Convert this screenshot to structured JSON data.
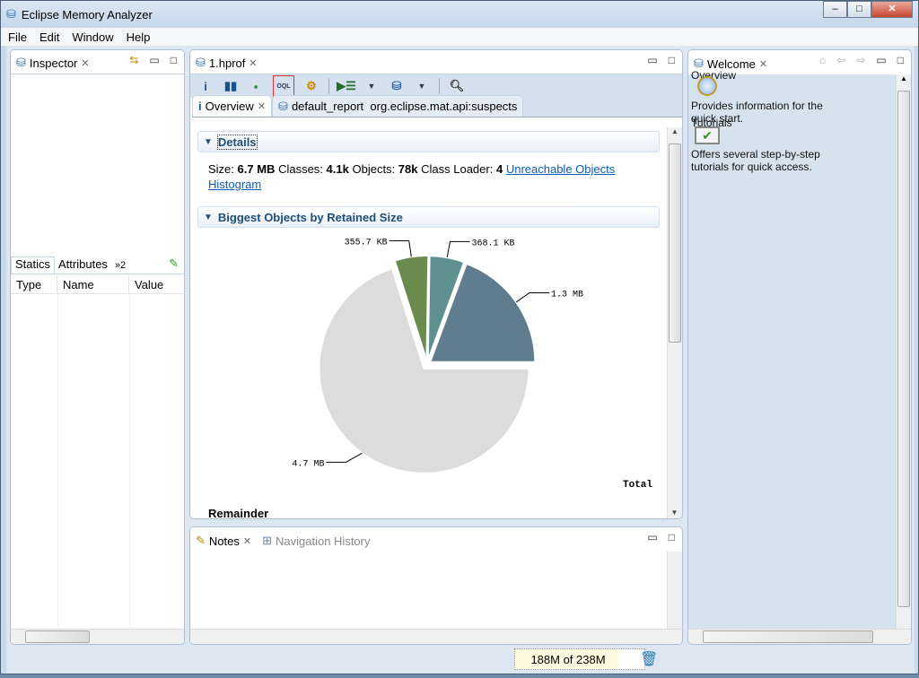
{
  "window": {
    "title": "Eclipse Memory Analyzer",
    "min": "–",
    "max": "□",
    "close": "✕"
  },
  "menu": [
    "File",
    "Edit",
    "Window",
    "Help"
  ],
  "inspector": {
    "tab": "Inspector",
    "subtabs": [
      "Statics",
      "Attributes",
      "»2"
    ],
    "columns": [
      "Type",
      "Name",
      "Value"
    ]
  },
  "editor": {
    "tab": "1.hprof",
    "subtabs": [
      "Overview",
      "default_report  org.eclipse.mat.api:suspects"
    ],
    "details": {
      "header": "Details",
      "size_label": "Size:",
      "size": "6.7 MB",
      "classes_label": "Classes:",
      "classes": "4.1k",
      "objects_label": "Objects:",
      "objects": "78k",
      "loader_label": "Class Loader:",
      "loader": "4",
      "link": "Unreachable Objects Histogram"
    },
    "biggest": {
      "header": "Biggest Objects by Retained Size",
      "total_label": "Total",
      "remainder_label": "Remainder"
    }
  },
  "chart_data": {
    "type": "pie",
    "title": "Biggest Objects by Retained Size",
    "legend": "Total",
    "slices": [
      {
        "label": "1.3 MB",
        "value_kb": 1331.2,
        "color": "#5f7d8e"
      },
      {
        "label": "368.1 KB",
        "value_kb": 368.1,
        "color": "#5f9090"
      },
      {
        "label": "355.7 KB",
        "value_kb": 355.7,
        "color": "#6b8a4e"
      },
      {
        "label": "4.7 MB",
        "value_kb": 4812.8,
        "color": "#dcdcdc",
        "name": "Remainder"
      }
    ]
  },
  "notes": {
    "tab": "Notes",
    "tab2": "Navigation History"
  },
  "welcome": {
    "tab": "Welcome",
    "overview_title": "Overview",
    "overview_desc": "Provides information for the quick start.",
    "tutorials_title": "Tutorials",
    "tutorials_desc": "Offers several step-by-step tutorials for quick access."
  },
  "status": {
    "heap": "188M of 238M",
    "heap_used_fraction": 0.79
  }
}
